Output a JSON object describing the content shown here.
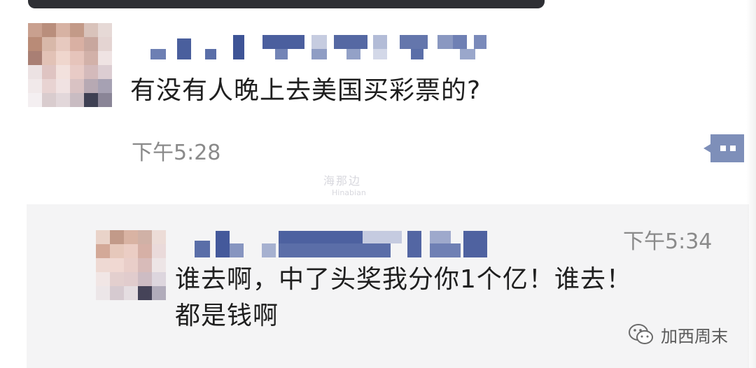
{
  "messages": [
    {
      "text": "有没有人晚上去美国买彩票的?",
      "time": "下午5:28"
    },
    {
      "text_line1": "谁去啊，中了头奖我分你1个亿！谁去！",
      "text_line2": "都是钱啊",
      "time": "下午5:34"
    }
  ],
  "watermark": {
    "brand": "加西周末",
    "center_line1": "海那边",
    "center_line2": "Hinabian"
  },
  "colors": {
    "username_blur": "#5a6ea8",
    "comment_icon": "#7e8fb9",
    "reply_background": "#f4f4f5"
  },
  "icons": {
    "comment": "comment-icon",
    "brand": "wechat-icon"
  }
}
